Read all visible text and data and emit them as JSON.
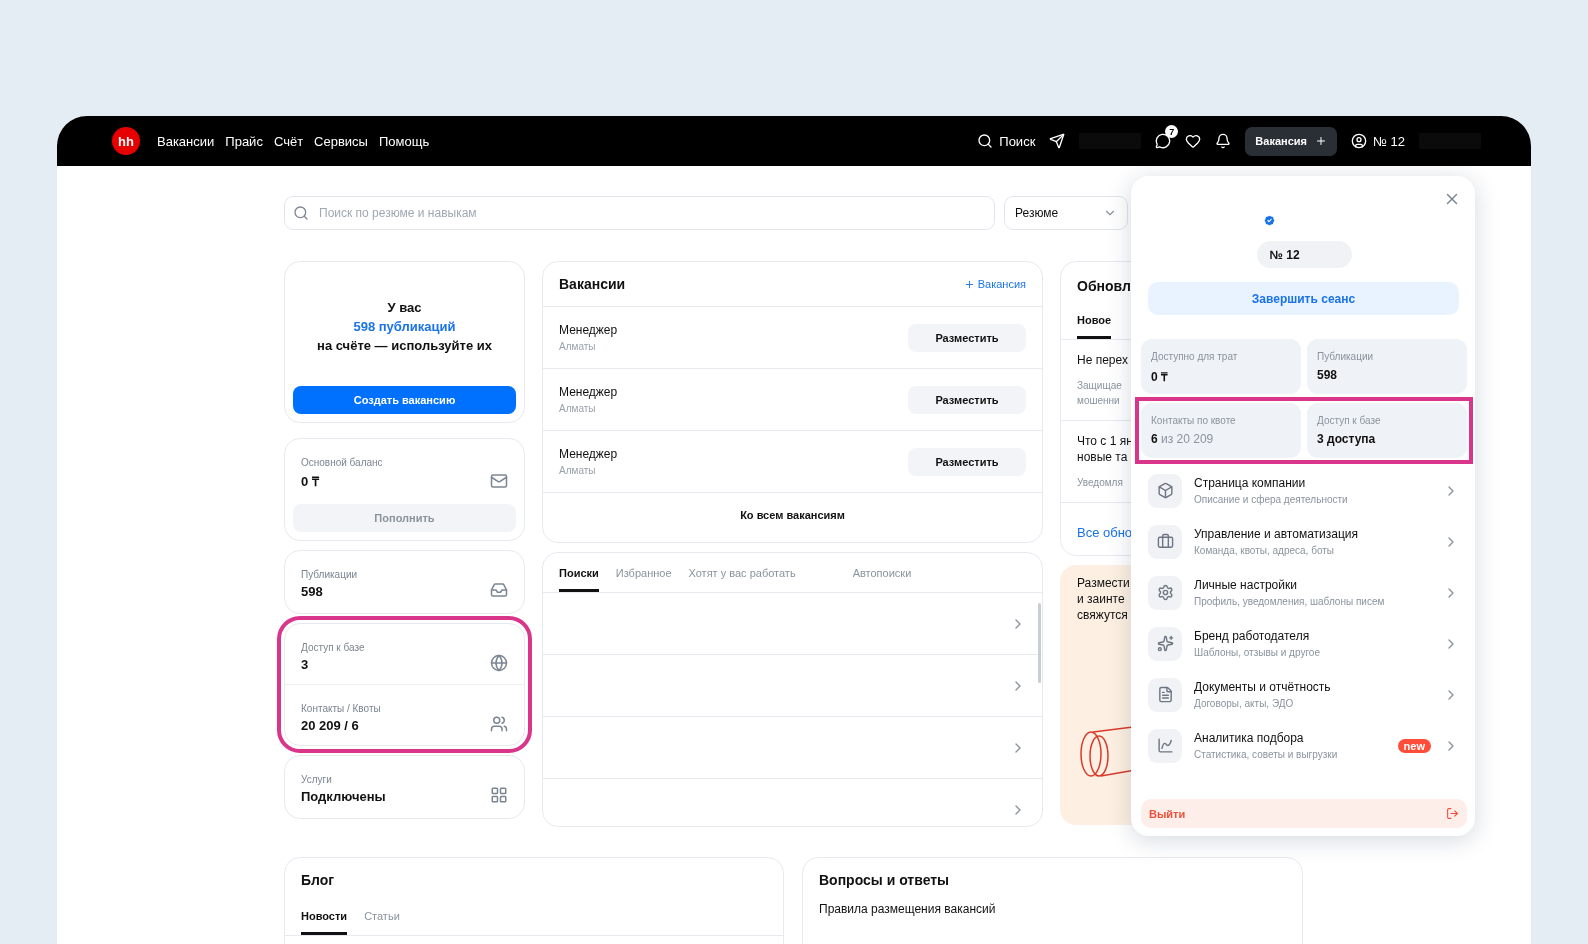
{
  "header": {
    "logo": "hh",
    "nav": [
      {
        "label": "Вакансии"
      },
      {
        "label": "Прайс"
      },
      {
        "label": "Счёт"
      },
      {
        "label": "Сервисы"
      },
      {
        "label": "Помощь"
      }
    ],
    "search": "Поиск",
    "messages_badge": "7",
    "vacancy_button": "Вакансия",
    "account": "№ 12"
  },
  "search": {
    "placeholder": "Поиск по резюме и навыкам",
    "type_select": "Резюме"
  },
  "summary_card": {
    "line1": "У вас",
    "publications_link": "598 публикаций",
    "line3": "на счёте — используйте их",
    "button": "Создать вакансию"
  },
  "balance_card": {
    "label": "Основной баланс",
    "value": "0 ₸",
    "button": "Пополнить"
  },
  "publications_card": {
    "label": "Публикации",
    "value": "598"
  },
  "access_group": {
    "highlighted": true,
    "items": [
      {
        "label": "Доступ к базе",
        "value": "3"
      },
      {
        "label": "Контакты / Квоты",
        "value": "20 209 / 6"
      }
    ]
  },
  "services_card": {
    "label": "Услуги",
    "value": "Подключены"
  },
  "vacancies": {
    "title": "Вакансии",
    "add_link": "Вакансия",
    "rows": [
      {
        "title": "Менеджер",
        "city": "Алматы",
        "button": "Разместить"
      },
      {
        "title": "Менеджер",
        "city": "Алматы",
        "button": "Разместить"
      },
      {
        "title": "Менеджер",
        "city": "Алматы",
        "button": "Разместить"
      }
    ],
    "footer_link": "Ко всем вакансиям"
  },
  "searches": {
    "tabs": [
      {
        "label": "Поиски",
        "selected": true
      },
      {
        "label": "Избранное",
        "selected": false
      },
      {
        "label": "Хотят у вас работать",
        "selected": false
      },
      {
        "label": "Автопоиски",
        "selected": false
      }
    ]
  },
  "updates": {
    "title": "Обновл",
    "tabs": [
      {
        "label": "Новое",
        "selected": true
      }
    ],
    "items": [
      {
        "title_lines": [
          "Не перех"
        ],
        "text_lines": [
          "Защищае",
          "мошенни"
        ]
      },
      {
        "title_lines": [
          "Что с 1 ян",
          "новые та"
        ],
        "text_lines": [
          "Уведомля"
        ]
      }
    ],
    "all_link": "Все обно"
  },
  "promo": {
    "lines": [
      "Размести",
      "и заинте",
      "свяжутся"
    ]
  },
  "profile_popup": {
    "name": "№ 12",
    "end_session": "Завершить сеанс",
    "stats": [
      {
        "label": "Доступно для трат",
        "value": "0 ₸"
      },
      {
        "label": "Публикации",
        "value": "598"
      }
    ],
    "quota_row": {
      "highlighted": true,
      "stats": [
        {
          "label": "Контакты по квоте",
          "value": "6",
          "suffix": "из 20 209"
        },
        {
          "label": "Доступ к базе",
          "value": "3 доступа"
        }
      ]
    },
    "menu": [
      {
        "title": "Страница компании",
        "subtitle": "Описание и сфера деятельности"
      },
      {
        "title": "Управление и автоматизация",
        "subtitle": "Команда, квоты, адреса, боты"
      },
      {
        "title": "Личные настройки",
        "subtitle": "Профиль, уведомления, шаблоны писем"
      },
      {
        "title": "Бренд работодателя",
        "subtitle": "Шаблоны, отзывы и другое"
      },
      {
        "title": "Документы и отчётность",
        "subtitle": "Договоры, акты, ЭДО"
      },
      {
        "title": "Аналитика подбора",
        "subtitle": "Статистика, советы и выгрузки",
        "badge": "new"
      }
    ],
    "logout": "Выйти"
  },
  "blog": {
    "title": "Блог",
    "tabs": [
      {
        "label": "Новости",
        "selected": true
      },
      {
        "label": "Статьи",
        "selected": false
      }
    ]
  },
  "faq": {
    "title": "Вопросы и ответы",
    "items": [
      "Правила размещения вакансий"
    ]
  }
}
